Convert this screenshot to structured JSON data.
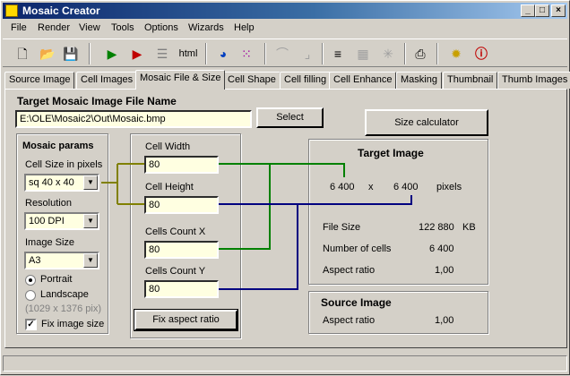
{
  "window": {
    "title": "Mosaic Creator",
    "controls": [
      "_",
      "□",
      "×"
    ]
  },
  "menu": [
    "File",
    "Render",
    "View",
    "Tools",
    "Options",
    "Wizards",
    "Help"
  ],
  "toolbar": {
    "html_label": "html"
  },
  "tabs": [
    "Source Image",
    "Cell Images",
    "Mosaic File & Size",
    "Cell Shape",
    "Cell filling",
    "Cell Enhance",
    "Masking",
    "Thumbnail",
    "Thumb Images"
  ],
  "active_tab": "Mosaic File & Size",
  "target_file": {
    "heading": "Target Mosaic Image File Name",
    "path": "E:\\OLE\\Mosaic2\\Out\\Mosaic.bmp",
    "select_label": "Select"
  },
  "size_calculator_label": "Size calculator",
  "mosaic_params": {
    "heading": "Mosaic params",
    "cell_size_label": "Cell Size in pixels",
    "cell_size_value": "sq 40 x 40",
    "resolution_label": "Resolution",
    "resolution_value": "100 DPI",
    "image_size_label": "Image Size",
    "image_size_value": "A3",
    "portrait_label": "Portrait",
    "landscape_label": "Landscape",
    "landscape_dims": "(1029 x 1376 pix)",
    "fix_image_size_label": "Fix image size"
  },
  "cells": {
    "width_label": "Cell Width",
    "width_value": "80",
    "height_label": "Cell Height",
    "height_value": "80",
    "count_x_label": "Cells Count X",
    "count_x_value": "80",
    "count_y_label": "Cells Count Y",
    "count_y_value": "80",
    "fix_aspect_label": "Fix aspect ratio"
  },
  "target_image": {
    "heading": "Target Image",
    "width": "6 400",
    "times": "x",
    "height": "6 400",
    "unit": "pixels",
    "file_size_label": "File Size",
    "file_size_value": "122 880",
    "file_size_unit": "KB",
    "num_cells_label": "Number of cells",
    "num_cells_value": "6 400",
    "aspect_label": "Aspect ratio",
    "aspect_value": "1,00"
  },
  "source_image": {
    "heading": "Source Image",
    "aspect_label": "Aspect ratio",
    "aspect_value": "1,00"
  },
  "colors": {
    "wire_olive": "#808000",
    "wire_green": "#008000",
    "wire_navy": "#000080"
  }
}
